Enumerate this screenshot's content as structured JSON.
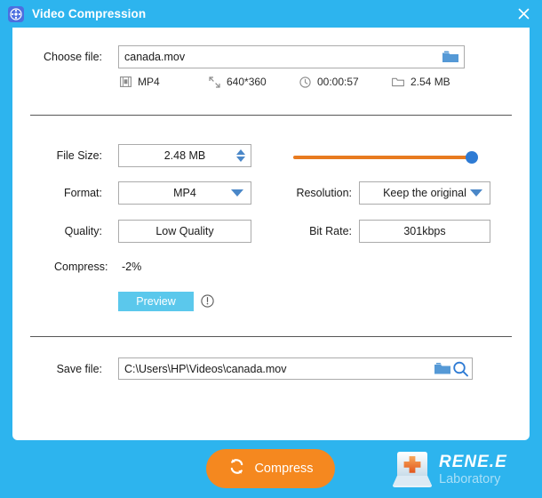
{
  "titlebar": {
    "title": "Video Compression",
    "app_icon": "film-reel-icon",
    "close_icon": "close-icon",
    "bg_color": "#2DB4EE"
  },
  "choose_file": {
    "label": "Choose file:",
    "value": "canada.mov",
    "placeholder": "",
    "browse_icon": "folder-icon"
  },
  "meta": [
    {
      "icon": "film-strip-icon",
      "text": "MP4"
    },
    {
      "icon": "resize-icon",
      "text": "640*360"
    },
    {
      "icon": "clock-icon",
      "text": "00:00:57"
    },
    {
      "icon": "folder-outline-icon",
      "text": "2.54 MB"
    }
  ],
  "settings": {
    "file_size": {
      "label": "File Size:",
      "value": "2.48  MB",
      "spinner_up_icon": "triangle-up-icon",
      "spinner_down_icon": "triangle-down-icon"
    },
    "format": {
      "label": "Format:",
      "value": "MP4",
      "arrow_icon": "chevron-down-icon"
    },
    "quality": {
      "label": "Quality:",
      "value": "Low Quality"
    },
    "resolution": {
      "label": "Resolution:",
      "value": "Keep the original",
      "arrow_icon": "chevron-down-icon"
    },
    "bit_rate": {
      "label": "Bit Rate:",
      "value": "301kbps"
    },
    "slider": {
      "track_color": "#E87B20",
      "handle_color": "#2E7BD4",
      "position_percent": 96
    }
  },
  "compress_ratio": {
    "label": "Compress:",
    "value": "-2%"
  },
  "preview": {
    "label": "Preview",
    "color": "#5BC8EC",
    "info_icon": "info-circle-icon"
  },
  "save_file": {
    "label": "Save file:",
    "value": "C:\\Users\\HP\\Videos\\canada.mov",
    "placeholder": "",
    "folder_icon": "folder-icon",
    "search_icon": "search-icon"
  },
  "footer": {
    "compress_button": {
      "label": "Compress",
      "icon": "refresh-cycle-icon",
      "color": "#F5881F"
    },
    "logo": {
      "mark_icon": "keyboard-key-cross-icon",
      "title": "RENE.E",
      "subtitle": "Laboratory"
    }
  }
}
